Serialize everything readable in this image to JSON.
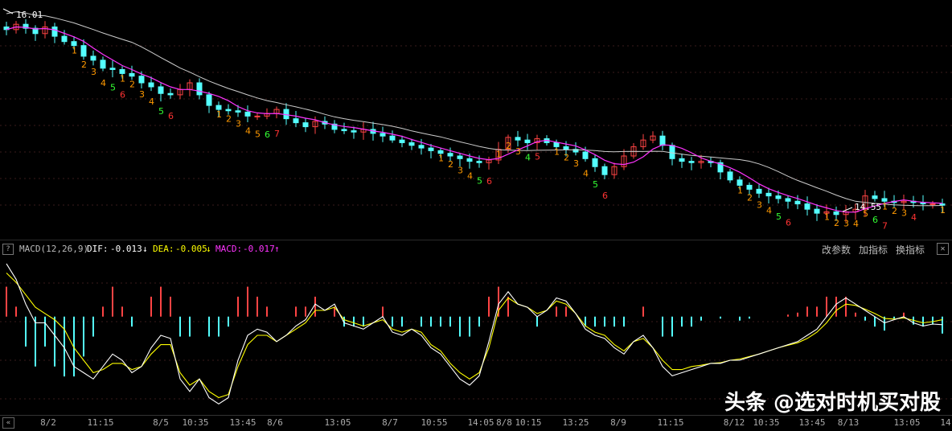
{
  "price_chart": {
    "high_label": "16.01",
    "low_label": "14.55",
    "colors": {
      "up": "#ff4444",
      "down": "#54ffff",
      "ma_fast": "#ff33ff",
      "ma_slow": "#cccccc",
      "seq_orange": "#ff9900",
      "seq_red": "#ff3333",
      "seq_green": "#33ff33"
    }
  },
  "macd_header": {
    "help": "?",
    "name": "MACD(12,26,9)",
    "dif_label": "DIF:",
    "dif_value": "-0.013",
    "dif_arrow": "↓",
    "dea_label": "DEA:",
    "dea_value": "-0.005",
    "dea_arrow": "↓",
    "macd_label": "MACD:",
    "macd_value": "-0.017",
    "macd_arrow": "↑",
    "tool_params": "改参数",
    "tool_add": "加指标",
    "tool_switch": "换指标",
    "close": "✕",
    "colors": {
      "dif": "#ffffff",
      "dea": "#ffff00",
      "macd": "#ff33ff"
    }
  },
  "time_axis": {
    "nav": "«",
    "ticks": [
      "8/2",
      "11:15",
      "8/5",
      "10:35",
      "13:45",
      "8/6",
      "13:05",
      "8/7",
      "10:55",
      "14:05",
      "8/8",
      "10:15",
      "13:25",
      "8/9",
      "11:15",
      "8/12",
      "10:35",
      "13:45",
      "8/13",
      "13:05",
      "14"
    ]
  },
  "watermark": "头条 @选对时机买对股",
  "chart_data": [
    {
      "type": "line",
      "title": "",
      "annotations": [
        "16.01",
        "14.55"
      ],
      "series": [
        {
          "values": [
            15.95,
            15.99,
            15.96,
            15.92,
            15.97,
            15.9,
            15.86,
            15.83,
            15.75,
            15.72,
            15.66,
            15.65,
            15.62,
            15.6,
            15.55,
            15.52,
            15.47,
            15.46,
            15.5,
            15.55,
            15.46,
            15.38,
            15.35,
            15.34,
            15.33,
            15.3,
            15.3,
            15.32,
            15.35,
            15.28,
            15.25,
            15.22,
            15.26,
            15.24,
            15.2,
            15.19,
            15.18,
            15.2,
            15.17,
            15.15,
            15.12,
            15.1,
            15.08,
            15.06,
            15.04,
            15.02,
            15.0,
            14.98,
            14.96,
            14.95,
            14.97,
            15.05,
            15.14,
            15.12,
            15.1,
            15.13,
            15.1,
            15.07,
            15.05,
            15.03,
            14.98,
            14.92,
            14.86,
            14.92,
            15.0,
            15.07,
            15.12,
            15.15,
            15.08,
            14.98,
            14.96,
            14.95,
            14.96,
            14.95,
            14.88,
            14.82,
            14.78,
            14.75,
            14.72,
            14.7,
            14.68,
            14.66,
            14.64,
            14.6,
            14.57,
            14.58,
            14.56,
            14.58,
            14.6,
            14.7,
            14.68,
            14.66,
            14.65,
            14.66,
            14.65,
            14.64,
            14.64,
            14.63
          ]
        }
      ]
    },
    {
      "type": "bar",
      "title": "",
      "series": [
        {
          "name": "DIF",
          "values": [
            0.085,
            0.06,
            0.02,
            -0.01,
            -0.01,
            -0.03,
            -0.05,
            -0.08,
            -0.09,
            -0.1,
            -0.08,
            -0.06,
            -0.07,
            -0.09,
            -0.08,
            -0.05,
            -0.03,
            -0.035,
            -0.1,
            -0.12,
            -0.1,
            -0.13,
            -0.14,
            -0.13,
            -0.07,
            -0.03,
            -0.02,
            -0.025,
            -0.04,
            -0.03,
            -0.015,
            -0.005,
            0.02,
            0.01,
            0.02,
            -0.01,
            -0.015,
            -0.02,
            -0.01,
            0.0,
            -0.025,
            -0.03,
            -0.02,
            -0.03,
            -0.05,
            -0.06,
            -0.08,
            -0.1,
            -0.11,
            -0.095,
            -0.04,
            0.02,
            0.04,
            0.02,
            0.015,
            0.0,
            0.01,
            0.03,
            0.025,
            0.005,
            -0.02,
            -0.03,
            -0.035,
            -0.05,
            -0.06,
            -0.04,
            -0.03,
            -0.05,
            -0.08,
            -0.095,
            -0.09,
            -0.085,
            -0.08,
            -0.075,
            -0.075,
            -0.07,
            -0.07,
            -0.065,
            -0.06,
            -0.055,
            -0.05,
            -0.045,
            -0.04,
            -0.03,
            -0.02,
            0.0,
            0.02,
            0.03,
            0.02,
            0.01,
            0.0,
            -0.01,
            -0.005,
            0.0,
            -0.01,
            -0.015,
            -0.012,
            -0.013
          ]
        },
        {
          "name": "DEA",
          "values": [
            0.07,
            0.055,
            0.035,
            0.015,
            0.005,
            -0.005,
            -0.02,
            -0.05,
            -0.07,
            -0.09,
            -0.085,
            -0.075,
            -0.075,
            -0.085,
            -0.08,
            -0.06,
            -0.045,
            -0.045,
            -0.09,
            -0.11,
            -0.1,
            -0.12,
            -0.13,
            -0.125,
            -0.08,
            -0.045,
            -0.03,
            -0.03,
            -0.04,
            -0.03,
            -0.02,
            -0.01,
            0.01,
            0.01,
            0.015,
            -0.005,
            -0.01,
            -0.015,
            -0.01,
            -0.005,
            -0.02,
            -0.025,
            -0.02,
            -0.025,
            -0.045,
            -0.055,
            -0.075,
            -0.09,
            -0.1,
            -0.09,
            -0.05,
            0.01,
            0.03,
            0.02,
            0.015,
            0.005,
            0.01,
            0.025,
            0.02,
            0.005,
            -0.015,
            -0.025,
            -0.03,
            -0.045,
            -0.055,
            -0.04,
            -0.035,
            -0.05,
            -0.07,
            -0.085,
            -0.085,
            -0.08,
            -0.078,
            -0.075,
            -0.074,
            -0.07,
            -0.068,
            -0.064,
            -0.06,
            -0.055,
            -0.05,
            -0.046,
            -0.042,
            -0.035,
            -0.025,
            -0.01,
            0.01,
            0.02,
            0.018,
            0.012,
            0.005,
            -0.003,
            -0.004,
            -0.002,
            -0.006,
            -0.01,
            -0.008,
            -0.005
          ]
        },
        {
          "name": "MACD",
          "values": [
            0.03,
            0.01,
            -0.03,
            -0.05,
            -0.03,
            -0.05,
            -0.06,
            -0.06,
            -0.04,
            -0.02,
            0.01,
            0.03,
            0.01,
            -0.01,
            0.0,
            0.02,
            0.03,
            0.02,
            -0.02,
            -0.02,
            0.0,
            -0.02,
            -0.02,
            -0.01,
            0.02,
            0.03,
            0.02,
            0.01,
            0.0,
            0.0,
            0.01,
            0.01,
            0.02,
            0.0,
            0.01,
            -0.01,
            -0.01,
            -0.01,
            0.0,
            0.01,
            -0.01,
            -0.01,
            0.0,
            -0.01,
            -0.01,
            -0.01,
            -0.01,
            -0.02,
            -0.02,
            -0.01,
            0.02,
            0.03,
            0.02,
            0.0,
            0.0,
            -0.01,
            0.0,
            0.01,
            0.01,
            0.0,
            -0.01,
            -0.01,
            -0.01,
            -0.01,
            -0.01,
            0.0,
            0.01,
            0.0,
            -0.02,
            -0.02,
            -0.01,
            -0.01,
            -0.004,
            0.0,
            -0.002,
            0.0,
            -0.004,
            -0.002,
            0.0,
            0.0,
            0.0,
            0.002,
            0.004,
            0.01,
            0.01,
            0.02,
            0.02,
            0.02,
            0.004,
            -0.004,
            -0.01,
            -0.014,
            -0.002,
            0.004,
            -0.008,
            -0.01,
            -0.008,
            -0.017
          ]
        }
      ]
    }
  ]
}
